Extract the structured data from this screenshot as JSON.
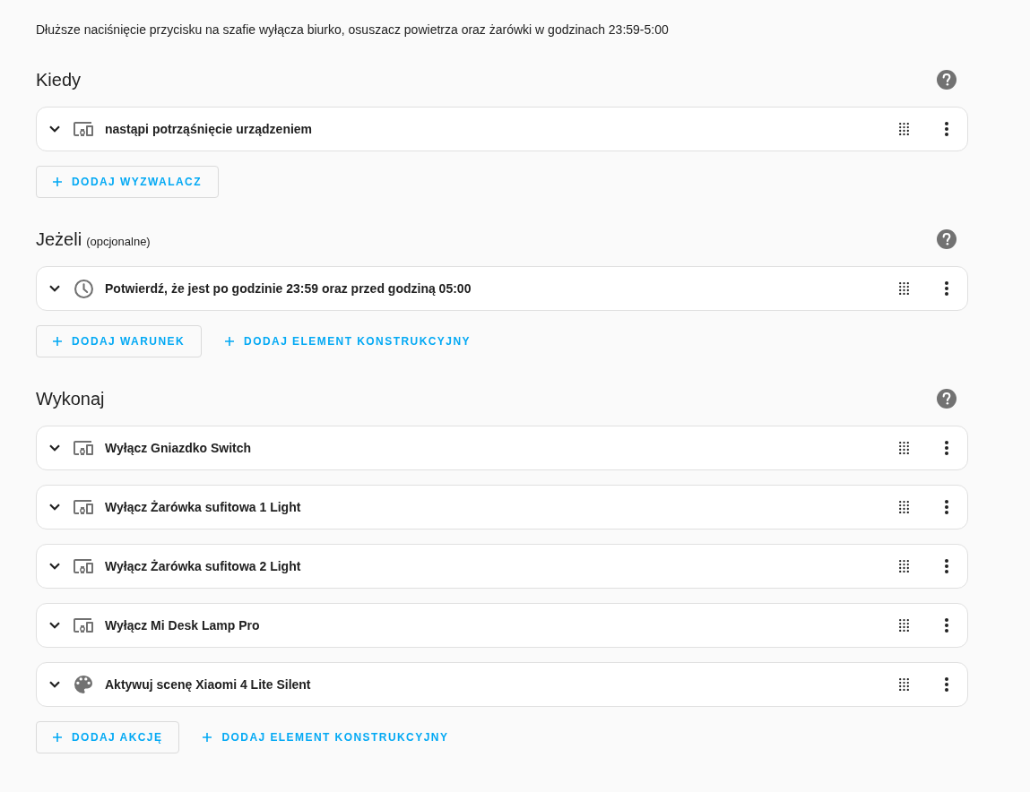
{
  "description": "Dłuższe naciśnięcie przycisku na szafie wyłącza biurko, osuszacz powietrza oraz żarówki w godzinach 23:59-5:00",
  "sections": [
    {
      "title": "Kiedy",
      "items": [
        {
          "kind": "device",
          "label": "nastąpi potrząśnięcie urządzeniem",
          "expanded": false
        }
      ],
      "buttons": [
        {
          "kind": "outlined",
          "label": "DODAJ WYZWALACZ"
        }
      ]
    },
    {
      "title": "Jeżeli",
      "note": "(opcjonalne)",
      "items": [
        {
          "kind": "time",
          "label": "Potwierdź, że jest po godzinie 23:59 oraz przed godziną 05:00",
          "expanded": false
        }
      ],
      "buttons": [
        {
          "kind": "outlined",
          "label": "DODAJ WARUNEK"
        },
        {
          "kind": "text",
          "label": "DODAJ ELEMENT KONSTRUKCYJNY"
        }
      ]
    },
    {
      "title": "Wykonaj",
      "items": [
        {
          "kind": "device",
          "label": "Wyłącz Gniazdko Switch",
          "expanded": false
        },
        {
          "kind": "device",
          "label": "Wyłącz Żarówka sufitowa 1 Light",
          "expanded": false
        },
        {
          "kind": "device",
          "label": "Wyłącz Żarówka sufitowa 2 Light",
          "expanded": false
        },
        {
          "kind": "device",
          "label": "Wyłącz Mi Desk Lamp Pro",
          "expanded": false
        },
        {
          "kind": "scene",
          "label": "Aktywuj scenę Xiaomi 4 Lite Silent",
          "expanded": false
        }
      ],
      "buttons": [
        {
          "kind": "outlined",
          "label": "DODAJ AKCJĘ"
        },
        {
          "kind": "text",
          "label": "DODAJ ELEMENT KONSTRUKCYJNY"
        }
      ]
    }
  ]
}
